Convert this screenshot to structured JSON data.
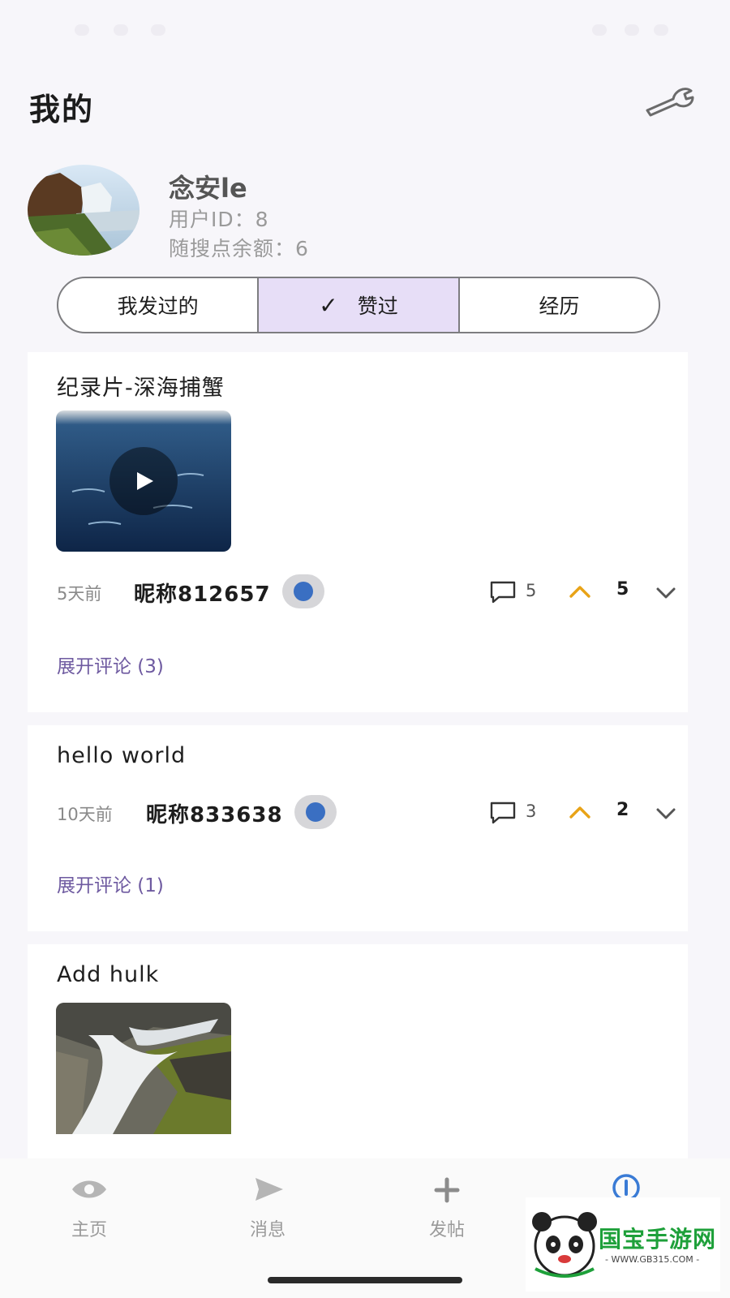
{
  "page": {
    "title": "我的",
    "settings_icon": "wrench-icon"
  },
  "profile": {
    "nickname": "念安le",
    "user_id": "用户ID：8",
    "balance": "随搜点余额：6"
  },
  "tabs": {
    "items": [
      {
        "label": "我发过的",
        "active": false
      },
      {
        "label": "赞过",
        "active": true
      },
      {
        "label": "经历",
        "active": false
      }
    ],
    "check_glyph": "✓"
  },
  "posts": [
    {
      "title": "纪录片-深海捕蟹",
      "media": "video",
      "time": "5天前",
      "author": "昵称812657",
      "comments": "5",
      "score": "5",
      "expand": "展开评论 (3)"
    },
    {
      "title": "hello world",
      "media": "none",
      "time": "10天前",
      "author": "昵称833638",
      "comments": "3",
      "score": "2",
      "expand": "展开评论 (1)"
    },
    {
      "title": "Add hulk",
      "media": "image"
    }
  ],
  "bottom_nav": {
    "items": [
      {
        "label": "主页",
        "icon": "eye-icon"
      },
      {
        "label": "消息",
        "icon": "send-icon"
      },
      {
        "label": "发帖",
        "icon": "plus-icon"
      },
      {
        "label": "",
        "icon": "info-icon"
      }
    ]
  },
  "watermark": {
    "text": "国宝手游网",
    "url": "- WWW.GB315.COM -"
  },
  "colors": {
    "accent": "#6e5aa0",
    "active_tab": "#e7def7",
    "upvote": "#e8a317",
    "nav_active": "#3a7bd5"
  }
}
